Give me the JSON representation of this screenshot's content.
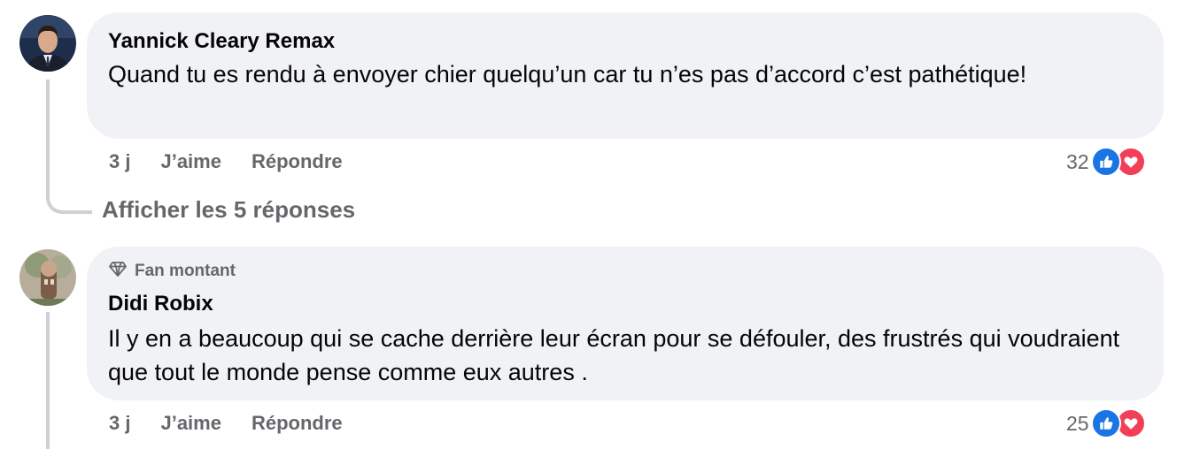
{
  "comments": [
    {
      "author": "Yannick Cleary Remax",
      "text": "Quand tu es rendu à envoyer chier quelqu’un car tu n’es pas d’accord c’est pathétique!",
      "time": "3 j",
      "like_label": "J’aime",
      "reply_label": "Répondre",
      "reaction_count": "32",
      "replies_label": "Afficher les 5 réponses"
    },
    {
      "badge": "Fan montant",
      "author": "Didi Robix",
      "text": "Il y en a beaucoup qui se cache derrière leur écran pour se défouler, des frustrés qui voudraient que tout le monde pense comme eux autres .",
      "time": "3 j",
      "like_label": "J’aime",
      "reply_label": "Répondre",
      "reaction_count": "25"
    }
  ],
  "colors": {
    "bubble": "#f0f2f5",
    "like": "#1b74e4",
    "love": "#f33e58",
    "meta": "#65676b"
  },
  "icons": [
    "like-icon",
    "love-icon",
    "rising-fan-diamond-icon"
  ]
}
